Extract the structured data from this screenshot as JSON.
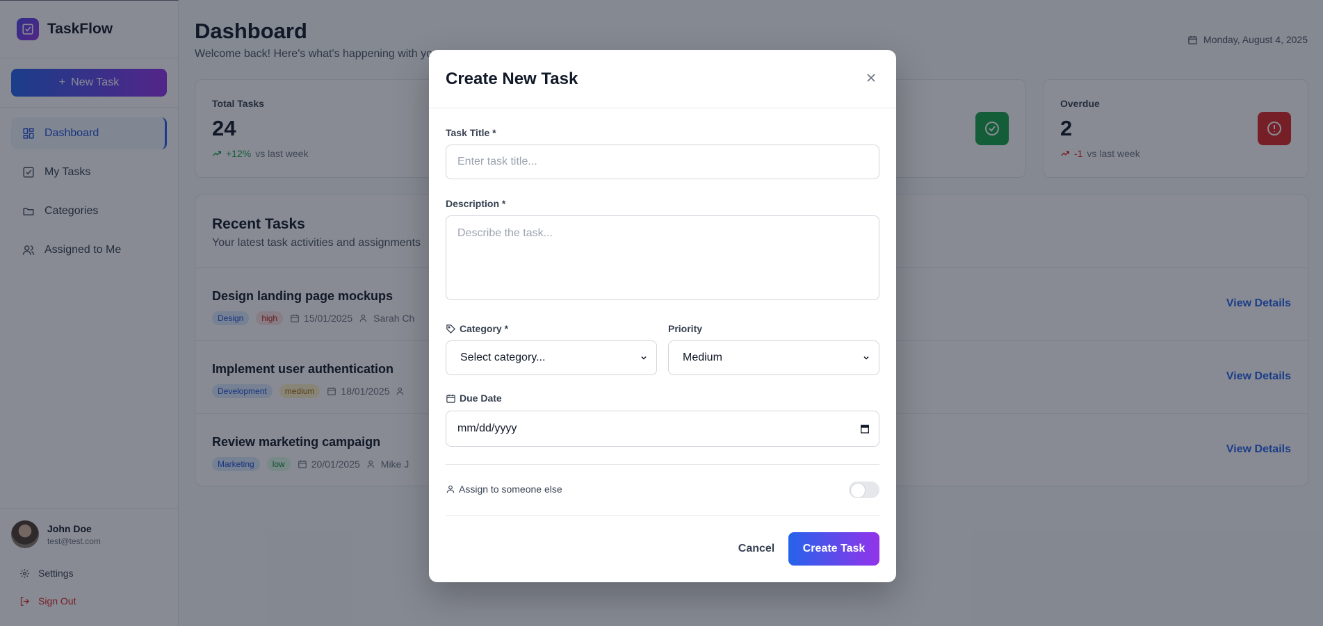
{
  "app": {
    "name": "TaskFlow",
    "new_task_label": "New Task"
  },
  "sidebar": {
    "items": [
      {
        "label": "Dashboard",
        "icon": "grid-icon",
        "active": true
      },
      {
        "label": "My Tasks",
        "icon": "check-square-icon"
      },
      {
        "label": "Categories",
        "icon": "folder-icon"
      },
      {
        "label": "Assigned to Me",
        "icon": "users-icon"
      }
    ],
    "user": {
      "name": "John Doe",
      "email": "test@test.com"
    },
    "settings_label": "Settings",
    "signout_label": "Sign Out"
  },
  "header": {
    "title": "Dashboard",
    "subtitle_visible": "Welcome back! Here's what's happening with yo",
    "date": "Monday, August 4, 2025"
  },
  "stats": [
    {
      "label": "Total Tasks",
      "value": "24",
      "trend": "+12%",
      "trend_suffix": "vs last week",
      "color": "#2563eb"
    },
    {
      "label": "Overdue",
      "value": "2",
      "trend": "-1",
      "trend_suffix": "vs last week",
      "color": "#dc2626"
    }
  ],
  "recent": {
    "title": "Recent Tasks",
    "subtitle": "Your latest task activities and assignments",
    "view_label": "View Details",
    "tasks": [
      {
        "title": "Design landing page mockups",
        "category": "Design",
        "priority": "high",
        "date": "15/01/2025",
        "assignee": "Sarah Ch"
      },
      {
        "title": "Implement user authentication",
        "category": "Development",
        "priority": "medium",
        "date": "18/01/2025",
        "assignee": ""
      },
      {
        "title": "Review marketing campaign",
        "category": "Marketing",
        "priority": "low",
        "date": "20/01/2025",
        "assignee": "Mike J"
      }
    ]
  },
  "modal": {
    "title": "Create New Task",
    "task_title_label": "Task Title *",
    "task_title_placeholder": "Enter task title...",
    "description_label": "Description *",
    "description_placeholder": "Describe the task...",
    "category_label": "Category *",
    "category_value": "Select category...",
    "priority_label": "Priority",
    "priority_value": "Medium",
    "due_label": "Due Date",
    "due_placeholder": "mm/dd/yyyy",
    "assign_label": "Assign to someone else",
    "assign_enabled": false,
    "cancel_label": "Cancel",
    "create_label": "Create Task"
  }
}
